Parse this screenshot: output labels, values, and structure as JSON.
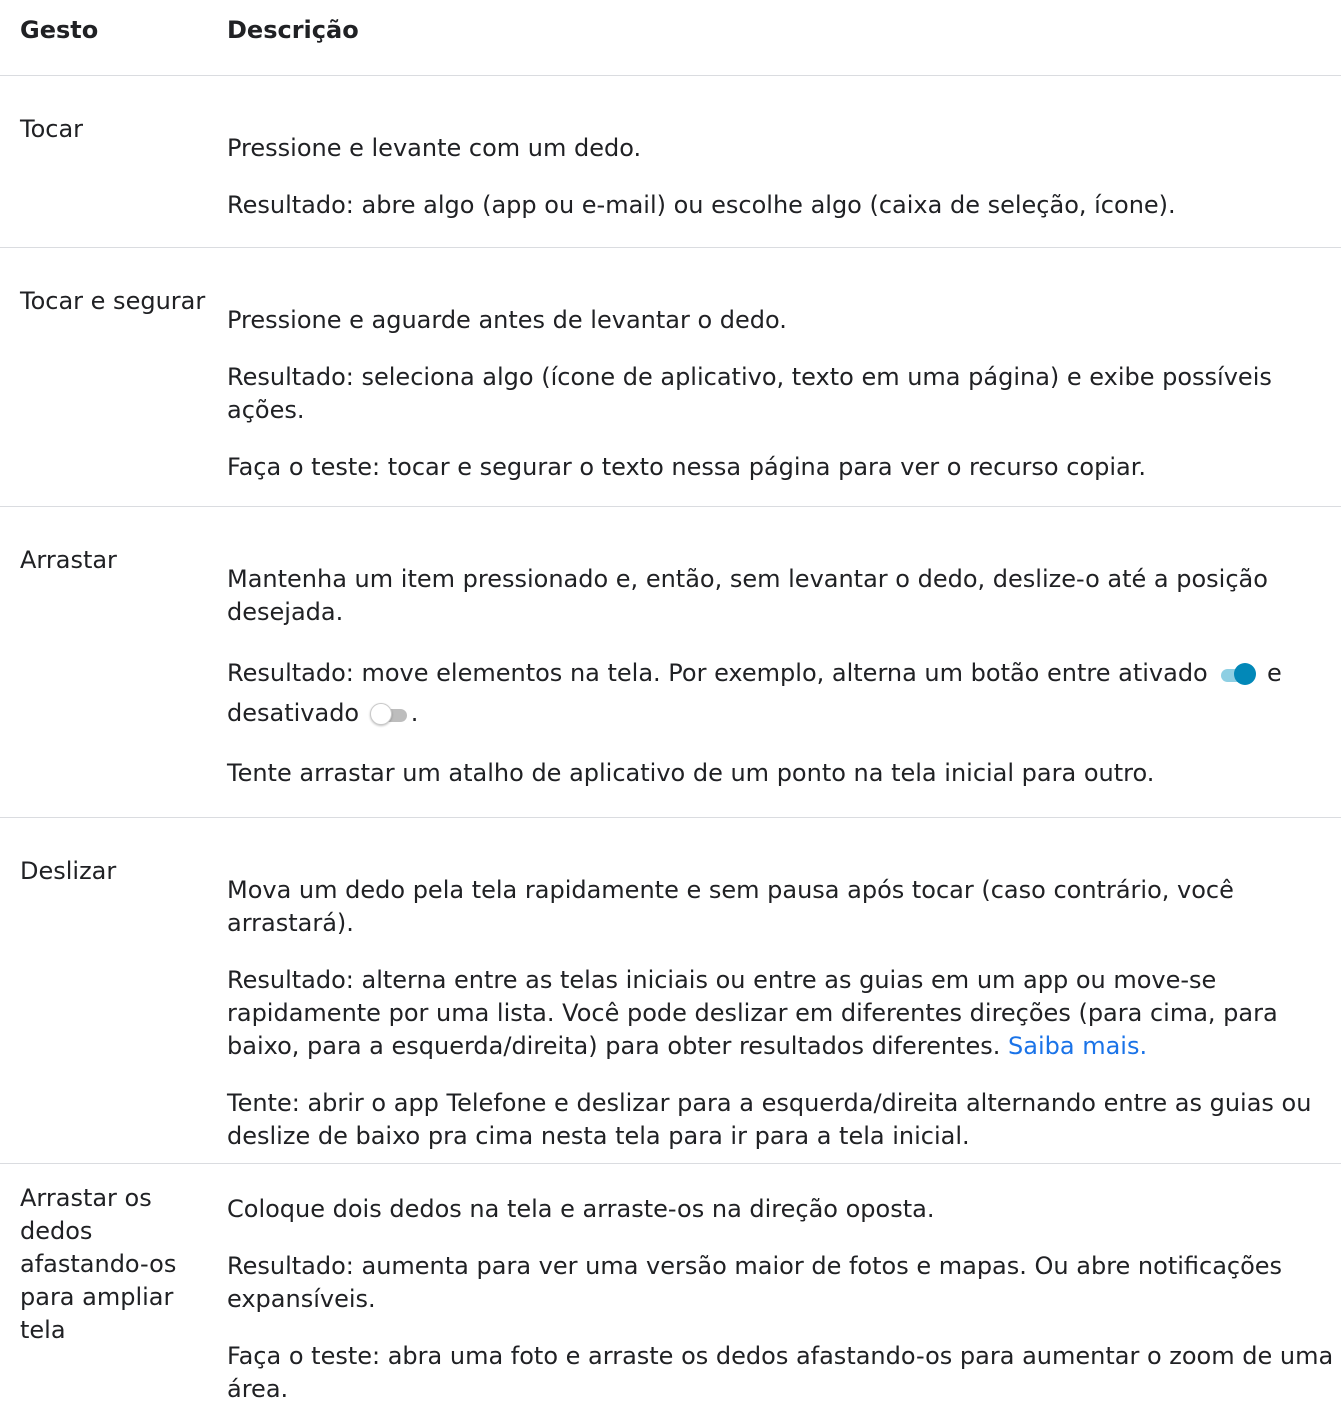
{
  "header": {
    "gesture_label": "Gesto",
    "description_label": "Descrição"
  },
  "rows": [
    {
      "gesture": "Tocar",
      "p1": "Pressione e levante com um dedo.",
      "p2": "Resultado: abre algo (app ou e-mail) ou escolhe algo (caixa de seleção, ícone)."
    },
    {
      "gesture": "Tocar e segurar",
      "p1": "Pressione e aguarde antes de levantar o dedo.",
      "p2": "Resultado: seleciona algo (ícone de aplicativo, texto em uma página) e exibe possíveis ações.",
      "p3": "Faça o teste: tocar e segurar o texto nessa página para ver o recurso copiar."
    },
    {
      "gesture": "Arrastar",
      "p1": "Mantenha um item pressionado e, então, sem levantar o dedo, deslize-o até a posição desejada.",
      "p2_before": "Resultado: move elementos na tela. Por exemplo, alterna um botão entre ativado",
      "p2_middle": "e desativado",
      "p2_after": ".",
      "p3": "Tente arrastar um atalho de aplicativo de um ponto na tela inicial para outro."
    },
    {
      "gesture": "Deslizar",
      "p1": "Mova um dedo pela tela rapidamente e sem pausa após tocar (caso contrário, você arrastará).",
      "p2": "Resultado: alterna entre as telas iniciais ou entre as guias em um app ou move-se rapidamente por uma lista. Você pode deslizar em diferentes direções (para cima, para baixo, para a esquerda/direita) para obter resultados diferentes.",
      "p2_link": "Saiba mais.",
      "p3": "Tente: abrir o app Telefone e deslizar para a esquerda/direita alternando entre as guias ou deslize de baixo pra cima nesta tela para ir para a tela inicial."
    },
    {
      "gesture": "Arrastar os dedos afastando-os para ampliar tela",
      "p1": "Coloque dois dedos na tela e arraste-os na direção oposta.",
      "p2": "Resultado: aumenta para ver uma versão maior de fotos e mapas. Ou abre notificações expansíveis.",
      "p3": "Faça o teste: abra uma foto e arraste os dedos afastando-os para aumentar o zoom de uma área."
    }
  ],
  "toggle_states": {
    "on": "toggle-on-icon",
    "off": "toggle-off-icon"
  },
  "colors": {
    "link": "#1a73e8",
    "divider": "#dadce0",
    "toggle_on_thumb": "#0288b8",
    "toggle_on_track": "#8ecfe3",
    "toggle_off_track": "#bdbdbd"
  }
}
